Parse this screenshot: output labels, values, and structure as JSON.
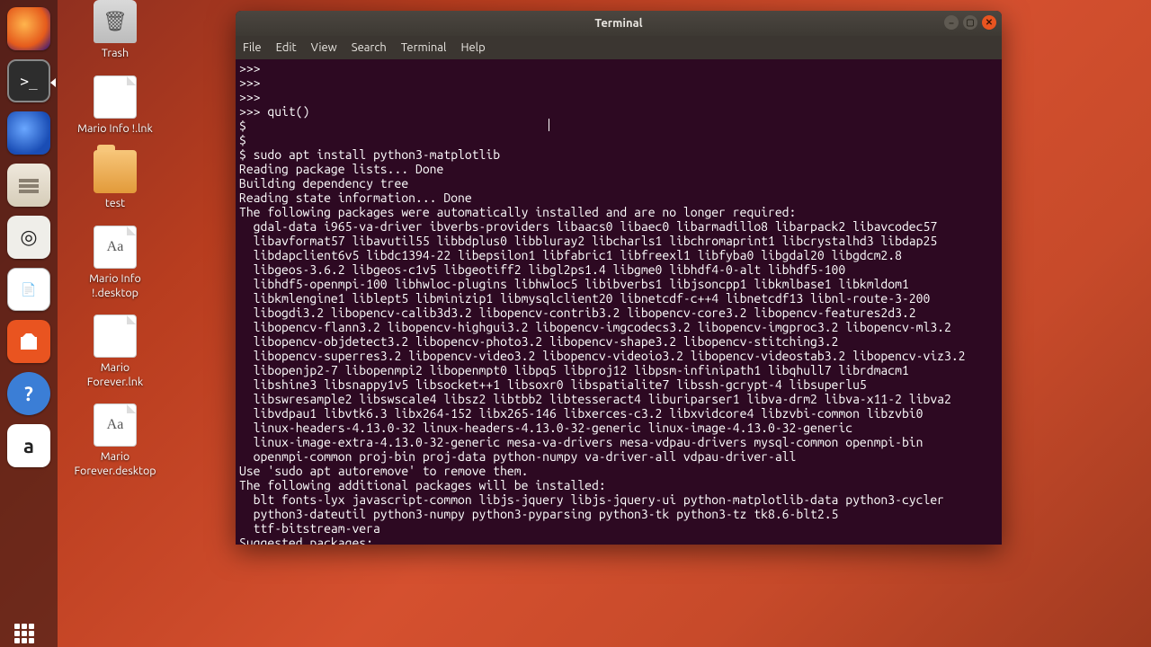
{
  "desktop": {
    "icons": [
      {
        "name": "trash",
        "label": "Trash",
        "glyph": "trash"
      },
      {
        "name": "mario-info-lnk",
        "label": "Mario Info !.lnk",
        "glyph": "file"
      },
      {
        "name": "test-folder",
        "label": "test",
        "glyph": "folder"
      },
      {
        "name": "mario-info-desktop",
        "label": "Mario Info !.desktop",
        "glyph": "file-aa"
      },
      {
        "name": "mario-forever-lnk",
        "label": "Mario Forever.lnk",
        "glyph": "file"
      },
      {
        "name": "mario-forever-desktop",
        "label": "Mario Forever.desktop",
        "glyph": "file-aa"
      }
    ]
  },
  "launcher": {
    "items": [
      {
        "name": "firefox",
        "title": "Firefox"
      },
      {
        "name": "terminal",
        "title": "Terminal",
        "active": true
      },
      {
        "name": "thunderbird",
        "title": "Thunderbird"
      },
      {
        "name": "files",
        "title": "Files"
      },
      {
        "name": "rhythmbox",
        "title": "Rhythmbox"
      },
      {
        "name": "writer",
        "title": "LibreOffice Writer"
      },
      {
        "name": "software",
        "title": "Ubuntu Software"
      },
      {
        "name": "help",
        "title": "Help"
      },
      {
        "name": "amazon",
        "title": "Amazon"
      }
    ]
  },
  "terminal": {
    "title": "Terminal",
    "menu": [
      "File",
      "Edit",
      "View",
      "Search",
      "Terminal",
      "Help"
    ],
    "cursor": {
      "col": 43,
      "row": 4
    },
    "lines": [
      ">>> ",
      ">>> ",
      ">>> ",
      ">>> quit()",
      "$ ",
      "$ ",
      "$ sudo apt install python3-matplotlib",
      "Reading package lists... Done",
      "Building dependency tree       ",
      "Reading state information... Done",
      "The following packages were automatically installed and are no longer required:",
      "  gdal-data i965-va-driver ibverbs-providers libaacs0 libaec0 libarmadillo8 libarpack2 libavcodec57",
      "  libavformat57 libavutil55 libbdplus0 libbluray2 libcharls1 libchromaprint1 libcrystalhd3 libdap25",
      "  libdapclient6v5 libdc1394-22 libepsilon1 libfabric1 libfreexl1 libfyba0 libgdal20 libgdcm2.8",
      "  libgeos-3.6.2 libgeos-c1v5 libgeotiff2 libgl2ps1.4 libgme0 libhdf4-0-alt libhdf5-100",
      "  libhdf5-openmpi-100 libhwloc-plugins libhwloc5 libibverbs1 libjsoncpp1 libkmlbase1 libkmldom1",
      "  libkmlengine1 liblept5 libminizip1 libmysqlclient20 libnetcdf-c++4 libnetcdf13 libnl-route-3-200",
      "  libogdi3.2 libopencv-calib3d3.2 libopencv-contrib3.2 libopencv-core3.2 libopencv-features2d3.2",
      "  libopencv-flann3.2 libopencv-highgui3.2 libopencv-imgcodecs3.2 libopencv-imgproc3.2 libopencv-ml3.2",
      "  libopencv-objdetect3.2 libopencv-photo3.2 libopencv-shape3.2 libopencv-stitching3.2",
      "  libopencv-superres3.2 libopencv-video3.2 libopencv-videoio3.2 libopencv-videostab3.2 libopencv-viz3.2",
      "  libopenjp2-7 libopenmpi2 libopenmpt0 libpq5 libproj12 libpsm-infinipath1 libqhull7 librdmacm1",
      "  libshine3 libsnappy1v5 libsocket++1 libsoxr0 libspatialite7 libssh-gcrypt-4 libsuperlu5",
      "  libswresample2 libswscale4 libsz2 libtbb2 libtesseract4 liburiparser1 libva-drm2 libva-x11-2 libva2",
      "  libvdpau1 libvtk6.3 libx264-152 libx265-146 libxerces-c3.2 libxvidcore4 libzvbi-common libzvbi0",
      "  linux-headers-4.13.0-32 linux-headers-4.13.0-32-generic linux-image-4.13.0-32-generic",
      "  linux-image-extra-4.13.0-32-generic mesa-va-drivers mesa-vdpau-drivers mysql-common openmpi-bin",
      "  openmpi-common proj-bin proj-data python-numpy va-driver-all vdpau-driver-all",
      "Use 'sudo apt autoremove' to remove them.",
      "The following additional packages will be installed:",
      "  blt fonts-lyx javascript-common libjs-jquery libjs-jquery-ui python-matplotlib-data python3-cycler",
      "  python3-dateutil python3-numpy python3-pyparsing python3-tk python3-tz tk8.6-blt2.5",
      "  ttf-bitstream-vera",
      "Suggested packages:"
    ]
  }
}
